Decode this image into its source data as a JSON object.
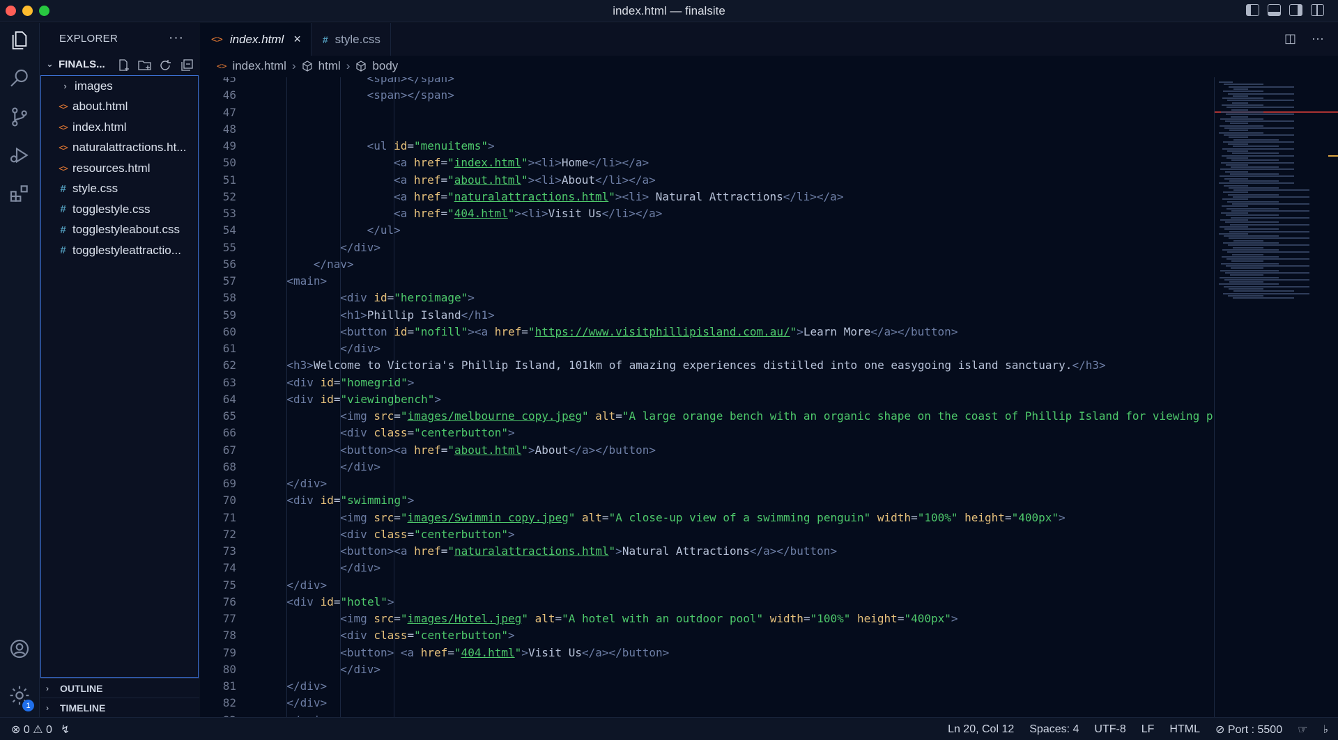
{
  "window": {
    "title": "index.html — finalsite"
  },
  "explorer": {
    "header": "EXPLORER",
    "more": "···",
    "project": "FINALS...",
    "items": [
      {
        "label": "images",
        "type": "folder"
      },
      {
        "label": "about.html",
        "type": "html"
      },
      {
        "label": "index.html",
        "type": "html"
      },
      {
        "label": "naturalattractions.ht...",
        "type": "html"
      },
      {
        "label": "resources.html",
        "type": "html"
      },
      {
        "label": "style.css",
        "type": "css"
      },
      {
        "label": "togglestyle.css",
        "type": "css"
      },
      {
        "label": "togglestyleabout.css",
        "type": "css"
      },
      {
        "label": "togglestyleattractio...",
        "type": "css"
      }
    ],
    "outline": "OUTLINE",
    "timeline": "TIMELINE"
  },
  "activity": {
    "settings_badge": "1"
  },
  "tabs": [
    {
      "label": "index.html",
      "active": true
    },
    {
      "label": "style.css",
      "active": false
    }
  ],
  "breadcrumb": [
    "index.html",
    "html",
    "body"
  ],
  "status": {
    "errors": "0",
    "warnings": "0",
    "position": "Ln 20, Col 12",
    "spaces": "Spaces: 4",
    "encoding": "UTF-8",
    "eol": "LF",
    "language": "HTML",
    "port": "Port : 5500"
  },
  "code": [
    {
      "n": "45",
      "i": 8,
      "parts": [
        [
          "t",
          "<span></span>"
        ]
      ]
    },
    {
      "n": "46",
      "i": 8,
      "parts": [
        [
          "t",
          "<span></span>"
        ]
      ]
    },
    {
      "n": "47",
      "i": 0,
      "parts": []
    },
    {
      "n": "48",
      "i": 0,
      "parts": []
    },
    {
      "n": "49",
      "i": 8,
      "parts": [
        [
          "t",
          "<ul "
        ],
        [
          "a",
          "id"
        ],
        [
          "x",
          "="
        ],
        [
          "s",
          "\"menuitems\""
        ],
        [
          "t",
          ">"
        ]
      ]
    },
    {
      "n": "50",
      "i": 10,
      "parts": [
        [
          "t",
          "<a "
        ],
        [
          "a",
          "href"
        ],
        [
          "x",
          "="
        ],
        [
          "s",
          "\""
        ],
        [
          "u",
          "index.html"
        ],
        [
          "s",
          "\""
        ],
        [
          "t",
          "><li>"
        ],
        [
          "x",
          "Home"
        ],
        [
          "t",
          "</li></a>"
        ]
      ]
    },
    {
      "n": "51",
      "i": 10,
      "parts": [
        [
          "t",
          "<a "
        ],
        [
          "a",
          "href"
        ],
        [
          "x",
          "="
        ],
        [
          "s",
          "\""
        ],
        [
          "u",
          "about.html"
        ],
        [
          "s",
          "\""
        ],
        [
          "t",
          "><li>"
        ],
        [
          "x",
          "About"
        ],
        [
          "t",
          "</li></a>"
        ]
      ]
    },
    {
      "n": "52",
      "i": 10,
      "parts": [
        [
          "t",
          "<a "
        ],
        [
          "a",
          "href"
        ],
        [
          "x",
          "="
        ],
        [
          "s",
          "\""
        ],
        [
          "u",
          "naturalattractions.html"
        ],
        [
          "s",
          "\""
        ],
        [
          "t",
          "><li>"
        ],
        [
          "x",
          " Natural Attractions"
        ],
        [
          "t",
          "</li></a>"
        ]
      ]
    },
    {
      "n": "53",
      "i": 10,
      "parts": [
        [
          "t",
          "<a "
        ],
        [
          "a",
          "href"
        ],
        [
          "x",
          "="
        ],
        [
          "s",
          "\""
        ],
        [
          "u",
          "404.html"
        ],
        [
          "s",
          "\""
        ],
        [
          "t",
          "><li>"
        ],
        [
          "x",
          "Visit Us"
        ],
        [
          "t",
          "</li></a>"
        ]
      ]
    },
    {
      "n": "54",
      "i": 8,
      "parts": [
        [
          "t",
          "</ul>"
        ]
      ]
    },
    {
      "n": "55",
      "i": 6,
      "parts": [
        [
          "t",
          "</div>"
        ]
      ]
    },
    {
      "n": "56",
      "i": 4,
      "parts": [
        [
          "t",
          "</nav>"
        ]
      ]
    },
    {
      "n": "57",
      "i": 2,
      "parts": [
        [
          "t",
          "<main>"
        ]
      ]
    },
    {
      "n": "58",
      "i": 6,
      "parts": [
        [
          "t",
          "<div "
        ],
        [
          "a",
          "id"
        ],
        [
          "x",
          "="
        ],
        [
          "s",
          "\"heroimage\""
        ],
        [
          "t",
          ">"
        ]
      ]
    },
    {
      "n": "59",
      "i": 6,
      "parts": [
        [
          "t",
          "<h1>"
        ],
        [
          "x",
          "Phillip Island"
        ],
        [
          "t",
          "</h1>"
        ]
      ]
    },
    {
      "n": "60",
      "i": 6,
      "parts": [
        [
          "t",
          "<button "
        ],
        [
          "a",
          "id"
        ],
        [
          "x",
          "="
        ],
        [
          "s",
          "\"nofill\""
        ],
        [
          "t",
          "><a "
        ],
        [
          "a",
          "href"
        ],
        [
          "x",
          "="
        ],
        [
          "s",
          "\""
        ],
        [
          "u",
          "https://www.visitphillipisland.com.au/"
        ],
        [
          "s",
          "\""
        ],
        [
          "t",
          ">"
        ],
        [
          "x",
          "Learn More"
        ],
        [
          "t",
          "</a></button>"
        ]
      ]
    },
    {
      "n": "61",
      "i": 6,
      "parts": [
        [
          "t",
          "</div>"
        ]
      ]
    },
    {
      "n": "62",
      "i": 2,
      "parts": [
        [
          "t",
          "<h3>"
        ],
        [
          "x",
          "Welcome to Victoria's Phillip Island, 101km of amazing experiences distilled into one easygoing island sanctuary."
        ],
        [
          "t",
          "</h3>"
        ]
      ]
    },
    {
      "n": "63",
      "i": 2,
      "parts": [
        [
          "t",
          "<div "
        ],
        [
          "a",
          "id"
        ],
        [
          "x",
          "="
        ],
        [
          "s",
          "\"homegrid\""
        ],
        [
          "t",
          ">"
        ]
      ]
    },
    {
      "n": "64",
      "i": 2,
      "parts": [
        [
          "t",
          "<div "
        ],
        [
          "a",
          "id"
        ],
        [
          "x",
          "="
        ],
        [
          "s",
          "\"viewingbench\""
        ],
        [
          "t",
          ">"
        ]
      ]
    },
    {
      "n": "65",
      "i": 6,
      "parts": [
        [
          "t",
          "<img "
        ],
        [
          "a",
          "src"
        ],
        [
          "x",
          "="
        ],
        [
          "s",
          "\""
        ],
        [
          "u",
          "images/melbourne copy.jpeg"
        ],
        [
          "s",
          "\""
        ],
        [
          "x",
          " "
        ],
        [
          "a",
          "alt"
        ],
        [
          "x",
          "="
        ],
        [
          "s",
          "\"A large orange bench with an organic shape on the coast of Phillip Island for viewing p"
        ]
      ]
    },
    {
      "n": "66",
      "i": 6,
      "parts": [
        [
          "t",
          "<div "
        ],
        [
          "a",
          "class"
        ],
        [
          "x",
          "="
        ],
        [
          "s",
          "\"centerbutton\""
        ],
        [
          "t",
          ">"
        ]
      ]
    },
    {
      "n": "67",
      "i": 6,
      "parts": [
        [
          "t",
          "<button><a "
        ],
        [
          "a",
          "href"
        ],
        [
          "x",
          "="
        ],
        [
          "s",
          "\""
        ],
        [
          "u",
          "about.html"
        ],
        [
          "s",
          "\""
        ],
        [
          "t",
          ">"
        ],
        [
          "x",
          "About"
        ],
        [
          "t",
          "</a></button>"
        ]
      ]
    },
    {
      "n": "68",
      "i": 6,
      "parts": [
        [
          "t",
          "</div>"
        ]
      ]
    },
    {
      "n": "69",
      "i": 2,
      "parts": [
        [
          "t",
          "</div>"
        ]
      ]
    },
    {
      "n": "70",
      "i": 2,
      "parts": [
        [
          "t",
          "<div "
        ],
        [
          "a",
          "id"
        ],
        [
          "x",
          "="
        ],
        [
          "s",
          "\"swimming\""
        ],
        [
          "t",
          ">"
        ]
      ]
    },
    {
      "n": "71",
      "i": 6,
      "parts": [
        [
          "t",
          "<img "
        ],
        [
          "a",
          "src"
        ],
        [
          "x",
          "="
        ],
        [
          "s",
          "\""
        ],
        [
          "u",
          "images/Swimmin copy.jpeg"
        ],
        [
          "s",
          "\""
        ],
        [
          "x",
          " "
        ],
        [
          "a",
          "alt"
        ],
        [
          "x",
          "="
        ],
        [
          "s",
          "\"A close-up view of a swimming penguin\""
        ],
        [
          "x",
          " "
        ],
        [
          "a",
          "width"
        ],
        [
          "x",
          "="
        ],
        [
          "s",
          "\"100%\""
        ],
        [
          "x",
          " "
        ],
        [
          "a",
          "height"
        ],
        [
          "x",
          "="
        ],
        [
          "s",
          "\"400px\""
        ],
        [
          "t",
          ">"
        ]
      ]
    },
    {
      "n": "72",
      "i": 6,
      "parts": [
        [
          "t",
          "<div "
        ],
        [
          "a",
          "class"
        ],
        [
          "x",
          "="
        ],
        [
          "s",
          "\"centerbutton\""
        ],
        [
          "t",
          ">"
        ]
      ]
    },
    {
      "n": "73",
      "i": 6,
      "parts": [
        [
          "t",
          "<button><a "
        ],
        [
          "a",
          "href"
        ],
        [
          "x",
          "="
        ],
        [
          "s",
          "\""
        ],
        [
          "u",
          "naturalattractions.html"
        ],
        [
          "s",
          "\""
        ],
        [
          "t",
          ">"
        ],
        [
          "x",
          "Natural Attractions"
        ],
        [
          "t",
          "</a></button>"
        ]
      ]
    },
    {
      "n": "74",
      "i": 6,
      "parts": [
        [
          "t",
          "</div>"
        ]
      ]
    },
    {
      "n": "75",
      "i": 2,
      "parts": [
        [
          "t",
          "</div>"
        ]
      ]
    },
    {
      "n": "76",
      "i": 2,
      "parts": [
        [
          "t",
          "<div "
        ],
        [
          "a",
          "id"
        ],
        [
          "x",
          "="
        ],
        [
          "s",
          "\"hotel\""
        ],
        [
          "t",
          ">"
        ]
      ]
    },
    {
      "n": "77",
      "i": 6,
      "parts": [
        [
          "t",
          "<img "
        ],
        [
          "a",
          "src"
        ],
        [
          "x",
          "="
        ],
        [
          "s",
          "\""
        ],
        [
          "u",
          "images/Hotel.jpeg"
        ],
        [
          "s",
          "\""
        ],
        [
          "x",
          " "
        ],
        [
          "a",
          "alt"
        ],
        [
          "x",
          "="
        ],
        [
          "s",
          "\"A hotel with an outdoor pool\""
        ],
        [
          "x",
          " "
        ],
        [
          "a",
          "width"
        ],
        [
          "x",
          "="
        ],
        [
          "s",
          "\"100%\""
        ],
        [
          "x",
          " "
        ],
        [
          "a",
          "height"
        ],
        [
          "x",
          "="
        ],
        [
          "s",
          "\"400px\""
        ],
        [
          "t",
          ">"
        ]
      ]
    },
    {
      "n": "78",
      "i": 6,
      "parts": [
        [
          "t",
          "<div "
        ],
        [
          "a",
          "class"
        ],
        [
          "x",
          "="
        ],
        [
          "s",
          "\"centerbutton\""
        ],
        [
          "t",
          ">"
        ]
      ]
    },
    {
      "n": "79",
      "i": 6,
      "parts": [
        [
          "t",
          "<button> <a "
        ],
        [
          "a",
          "href"
        ],
        [
          "x",
          "="
        ],
        [
          "s",
          "\""
        ],
        [
          "u",
          "404.html"
        ],
        [
          "s",
          "\""
        ],
        [
          "t",
          ">"
        ],
        [
          "x",
          "Visit Us"
        ],
        [
          "t",
          "</a></button>"
        ]
      ]
    },
    {
      "n": "80",
      "i": 6,
      "parts": [
        [
          "t",
          "</div>"
        ]
      ]
    },
    {
      "n": "81",
      "i": 2,
      "parts": [
        [
          "t",
          "</div>"
        ]
      ]
    },
    {
      "n": "82",
      "i": 2,
      "parts": [
        [
          "t",
          "</div>"
        ]
      ]
    },
    {
      "n": "83",
      "i": 2,
      "parts": [
        [
          "t",
          "</main>"
        ]
      ]
    }
  ]
}
